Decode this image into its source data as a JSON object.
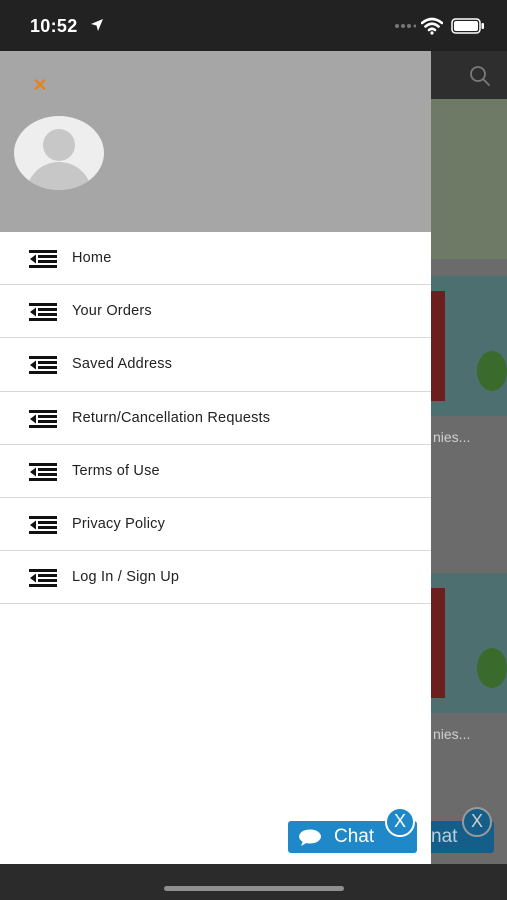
{
  "status_bar": {
    "time": "10:52",
    "icons": [
      "location-arrow-icon",
      "signal-dots-icon",
      "wifi-icon",
      "battery-icon"
    ]
  },
  "drawer": {
    "close_icon": "×",
    "accent_color": "#e8821e",
    "menu": [
      {
        "label": "Home",
        "icon": "menu-list-icon"
      },
      {
        "label": "Your Orders",
        "icon": "menu-list-icon"
      },
      {
        "label": "Saved Address",
        "icon": "menu-list-icon"
      },
      {
        "label": "Return/Cancellation Requests",
        "icon": "menu-list-icon"
      },
      {
        "label": "Terms of Use",
        "icon": "menu-list-icon"
      },
      {
        "label": "Privacy Policy",
        "icon": "menu-list-icon"
      },
      {
        "label": "Log In / Sign Up",
        "icon": "menu-list-icon"
      }
    ]
  },
  "background": {
    "product_text_1": "nies...",
    "product_text_2": "nies...",
    "chat_text": "nat",
    "close_label": "X"
  },
  "chat": {
    "label": "Chat",
    "close_label": "X",
    "color": "#1e88c8"
  }
}
